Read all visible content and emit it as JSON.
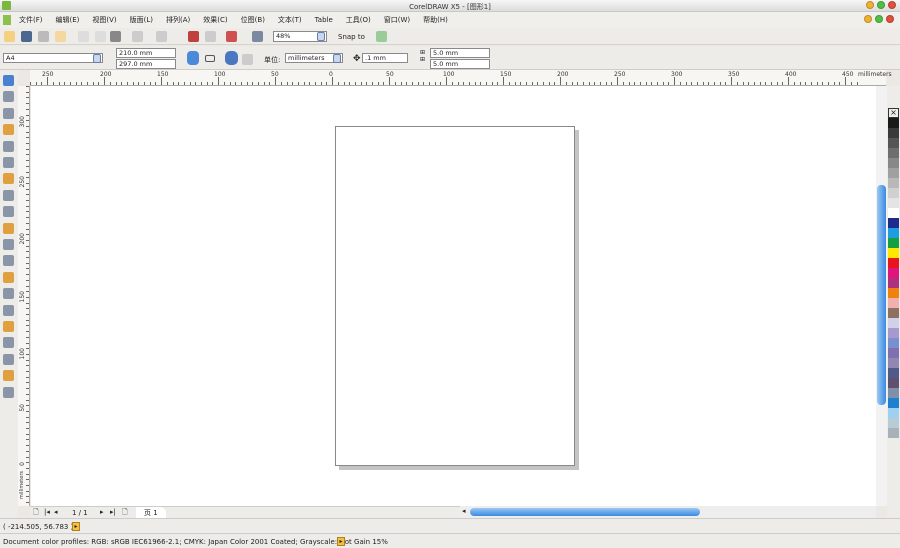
{
  "window": {
    "title": "CorelDRAW X5 - [图形1]"
  },
  "menu": [
    "文件(F)",
    "编辑(E)",
    "视图(V)",
    "版面(L)",
    "排列(A)",
    "效果(C)",
    "位图(B)",
    "文本(T)",
    "Table",
    "工具(O)",
    "窗口(W)",
    "帮助(H)"
  ],
  "toolbar": {
    "zoom": "48%",
    "snap_to": "Snap to"
  },
  "propbar": {
    "paper": "A4",
    "width": "210.0 mm",
    "height": "297.0 mm",
    "units_label": "单位:",
    "units": "millimeters",
    "nudge": ".1 mm",
    "dup_x": "5.0 mm",
    "dup_y": "5.0 mm"
  },
  "hruler": {
    "labels": [
      "250",
      "200",
      "150",
      "100",
      "50",
      "0",
      "50",
      "100",
      "150",
      "200",
      "250",
      "300",
      "350",
      "400",
      "450"
    ],
    "unit": "millimeters"
  },
  "vruler": {
    "labels": [
      "300",
      "250",
      "200",
      "150",
      "100",
      "50",
      "0"
    ],
    "unit": "millimeters"
  },
  "pagenav": {
    "count": "1 / 1",
    "tab": "页 1"
  },
  "status": {
    "coords": "( -214.505, 56.783 )",
    "profiles": "Document color profiles: RGB: sRGB IEC61966-2.1; CMYK: Japan Color 2001 Coated; Grayscale: Dot Gain 15%"
  },
  "palette": [
    "#1a1a1a",
    "#3a3a3a",
    "#555555",
    "#6e6e6e",
    "#888888",
    "#a0a0a0",
    "#b8b8b8",
    "#d0d0d0",
    "#e4e4e4",
    "#ffffff",
    "#1e2a8c",
    "#1e9de0",
    "#14a040",
    "#ffe800",
    "#e8141e",
    "#e0147a",
    "#b03080",
    "#f08010",
    "#f0b0b0",
    "#8c7060",
    "#d0d0e8",
    "#a898d0",
    "#7890d0",
    "#8070b0",
    "#9088b0",
    "#505a88",
    "#605070",
    "#8090a8",
    "#2080d0",
    "#a0d0f0",
    "#b8ccd8",
    "#a8b0b8"
  ]
}
